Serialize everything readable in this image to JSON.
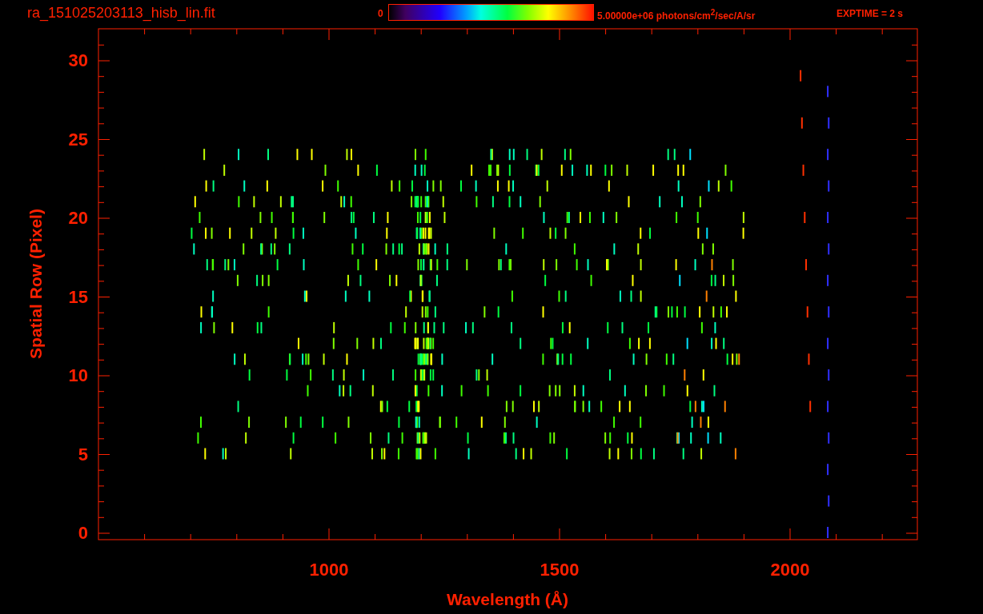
{
  "title": "ra_151025203113_hisb_lin.fit",
  "colorbar": {
    "min_label": "0",
    "max_label": "5.00000e+06 photons/cm$^{2}$/sec/A/sr"
  },
  "exptime": "EXPTIME = 2 s",
  "y_axis": {
    "label": "Spatial Row (Pixel)",
    "ticks": [
      "30",
      "25",
      "20",
      "15",
      "10",
      "5",
      "0"
    ]
  },
  "x_axis": {
    "label": "Wavelength (Å)",
    "ticks": [
      "1000",
      "1500",
      "2000"
    ]
  }
}
